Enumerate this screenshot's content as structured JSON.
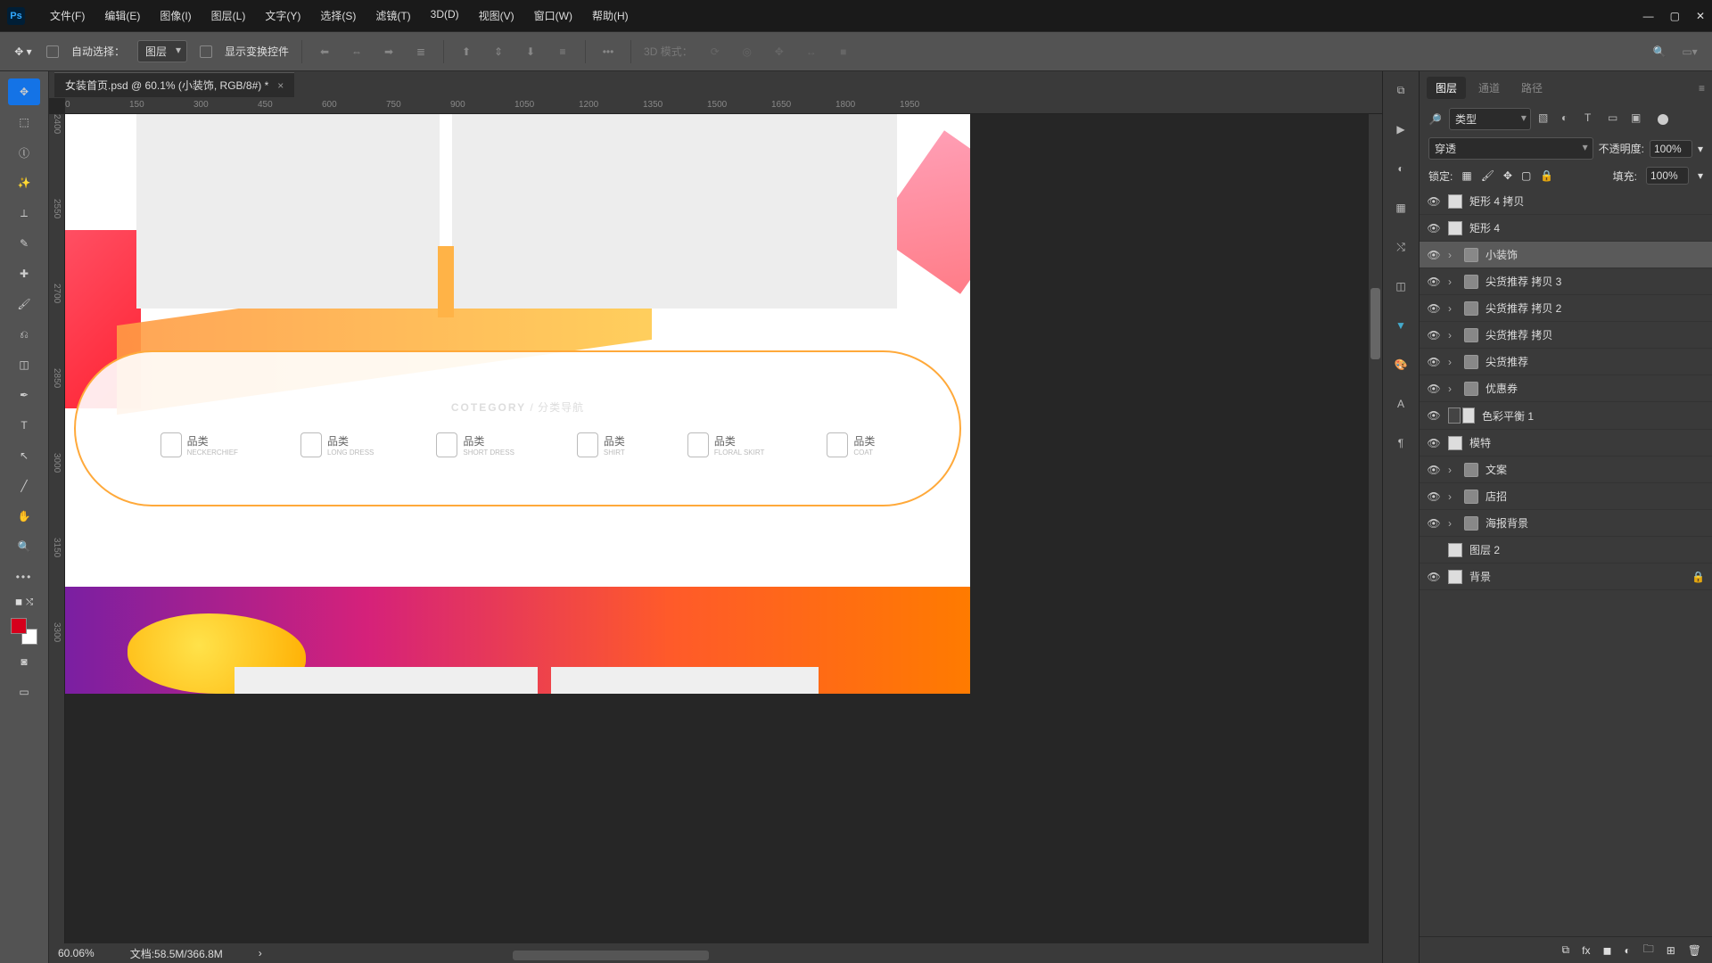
{
  "menubar": {
    "file": "文件(F)",
    "edit": "编辑(E)",
    "image": "图像(I)",
    "layer": "图层(L)",
    "type": "文字(Y)",
    "select": "选择(S)",
    "filter": "滤镜(T)",
    "threeD": "3D(D)",
    "view": "视图(V)",
    "window": "窗口(W)",
    "help": "帮助(H)"
  },
  "options": {
    "autoSelect": "自动选择：",
    "autoSelectTarget": "图层",
    "showTransform": "显示变换控件",
    "threeDMode": "3D 模式："
  },
  "doc": {
    "tab": "女装首页.psd @ 60.1% (小装饰, RGB/8#) *",
    "zoom": "60.06%",
    "docsize": "文档:58.5M/366.8M"
  },
  "ruler_h": [
    "0",
    "150",
    "300",
    "450",
    "600",
    "750",
    "900",
    "1050",
    "1200",
    "1350",
    "1500",
    "1650",
    "1800",
    "1950"
  ],
  "ruler_v": [
    "2400",
    "2550",
    "2700",
    "2850",
    "3000",
    "3150",
    "3300"
  ],
  "artboard": {
    "categoryTitle1": "COTEGORY",
    "categoryTitle2": " / 分类导航",
    "items": [
      {
        "zh": "品类",
        "en": "NECKERCHIEF"
      },
      {
        "zh": "品类",
        "en": "LONG DRESS"
      },
      {
        "zh": "品类",
        "en": "SHORT DRESS"
      },
      {
        "zh": "品类",
        "en": "SHIRT"
      },
      {
        "zh": "品类",
        "en": "FLORAL SKIRT"
      },
      {
        "zh": "品类",
        "en": "COAT"
      }
    ]
  },
  "panels": {
    "layersTab": "图层",
    "channelsTab": "通道",
    "pathsTab": "路径",
    "typeFilter": "类型",
    "blendMode": "穿透",
    "opacityLbl": "不透明度:",
    "opacityVal": "100%",
    "lockLbl": "锁定:",
    "fillLbl": "填充:",
    "fillVal": "100%"
  },
  "layers": [
    {
      "name": "矩形 4 拷贝",
      "type": "shape"
    },
    {
      "name": "矩形 4",
      "type": "shape"
    },
    {
      "name": "小装饰",
      "type": "folder",
      "selected": true
    },
    {
      "name": "尖货推荐 拷贝 3",
      "type": "folder"
    },
    {
      "name": "尖货推荐 拷贝 2",
      "type": "folder"
    },
    {
      "name": "尖货推荐 拷贝",
      "type": "folder"
    },
    {
      "name": "尖货推荐",
      "type": "folder"
    },
    {
      "name": "优惠券",
      "type": "folder"
    },
    {
      "name": "色彩平衡 1",
      "type": "adjust"
    },
    {
      "name": "模特",
      "type": "shape"
    },
    {
      "name": "文案",
      "type": "folder"
    },
    {
      "name": "店招",
      "type": "folder"
    },
    {
      "name": "海报背景",
      "type": "folder"
    },
    {
      "name": "图层 2",
      "type": "shape",
      "vis": false
    },
    {
      "name": "背景",
      "type": "shape",
      "locked": true
    }
  ]
}
